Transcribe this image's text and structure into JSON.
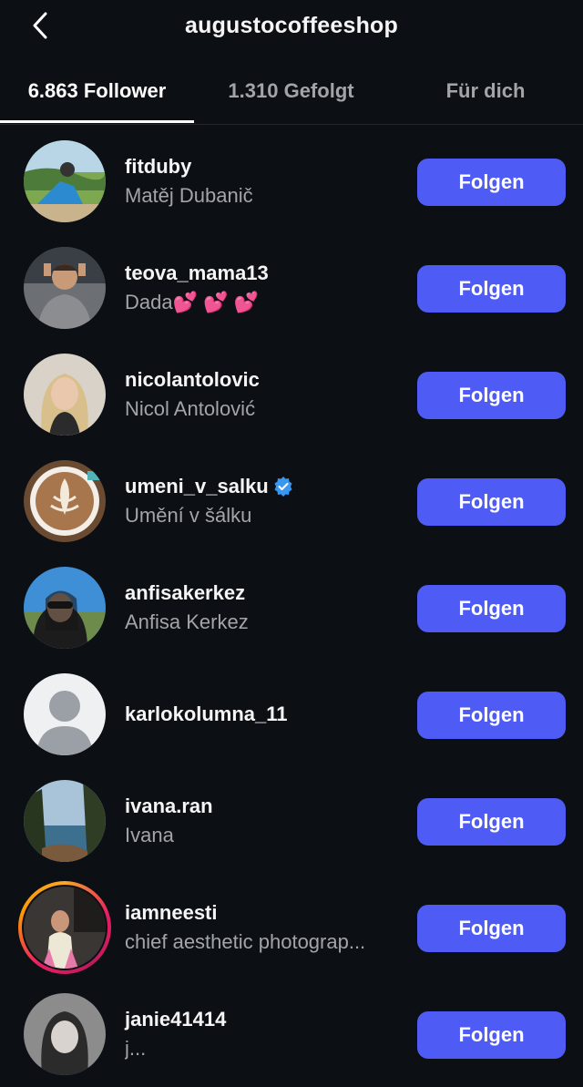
{
  "header": {
    "title": "augustocoffeeshop",
    "back_icon": "chevron-left-icon"
  },
  "tabs": [
    {
      "label": "6.863 Follower",
      "active": true
    },
    {
      "label": "1.310 Gefolgt",
      "active": false
    },
    {
      "label": "Für dich",
      "active": false
    }
  ],
  "colors": {
    "background": "#0c0f14",
    "button": "#4e5cf5",
    "secondary_text": "#a2a4a8",
    "verified": "#3897f0"
  },
  "followers": [
    {
      "username": "fitduby",
      "full_name": "Matěj Dubanič",
      "button": "Folgen"
    },
    {
      "username": "teova_mama13",
      "full_name": "Dada💕 💕 💕",
      "button": "Folgen"
    },
    {
      "username": "nicolantolovic",
      "full_name": "Nicol Antolović",
      "button": "Folgen"
    },
    {
      "username": "umeni_v_salku",
      "full_name": "Umění v šálku",
      "verified": true,
      "button": "Folgen"
    },
    {
      "username": "anfisakerkez",
      "full_name": "Anfisa Kerkez",
      "button": "Folgen"
    },
    {
      "username": "karlokolumna_11",
      "full_name": "",
      "button": "Folgen"
    },
    {
      "username": "ivana.ran",
      "full_name": "Ivana",
      "button": "Folgen"
    },
    {
      "username": "iamneesti",
      "full_name": "chief aesthetic photograp...",
      "story": true,
      "button": "Folgen"
    },
    {
      "username": "janie41414",
      "full_name": "j...",
      "button": "Folgen"
    }
  ]
}
